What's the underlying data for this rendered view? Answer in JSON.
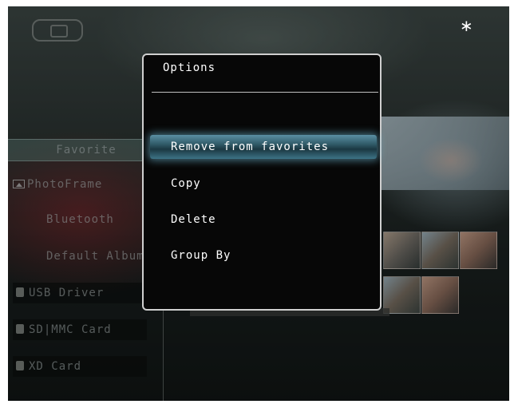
{
  "status": {
    "device_icon": "photoframe-device-icon",
    "bluetooth_icon": "bluetooth-icon",
    "bluetooth_glyph": "∗"
  },
  "sources": {
    "items": [
      {
        "label": "Favorite",
        "icon": "",
        "selected": true
      },
      {
        "label": "PhotoFrame",
        "icon": "photoframe-icon"
      },
      {
        "label": "Bluetooth",
        "icon": ""
      },
      {
        "label": "Default Album",
        "icon": ""
      },
      {
        "label": "USB Driver",
        "icon": "usb-icon"
      },
      {
        "label": "SD|MMC Card",
        "icon": "card-icon"
      },
      {
        "label": "XD Card",
        "icon": "card-icon"
      }
    ]
  },
  "dialog": {
    "title": "Options",
    "items": [
      {
        "label": "Remove from favorites",
        "active": true
      },
      {
        "label": "Copy"
      },
      {
        "label": "Delete"
      },
      {
        "label": "Group By"
      }
    ]
  },
  "colors": {
    "highlight": "#3d7386",
    "dialog_bg": "#070707",
    "dialog_border": "#cfcfcf"
  }
}
